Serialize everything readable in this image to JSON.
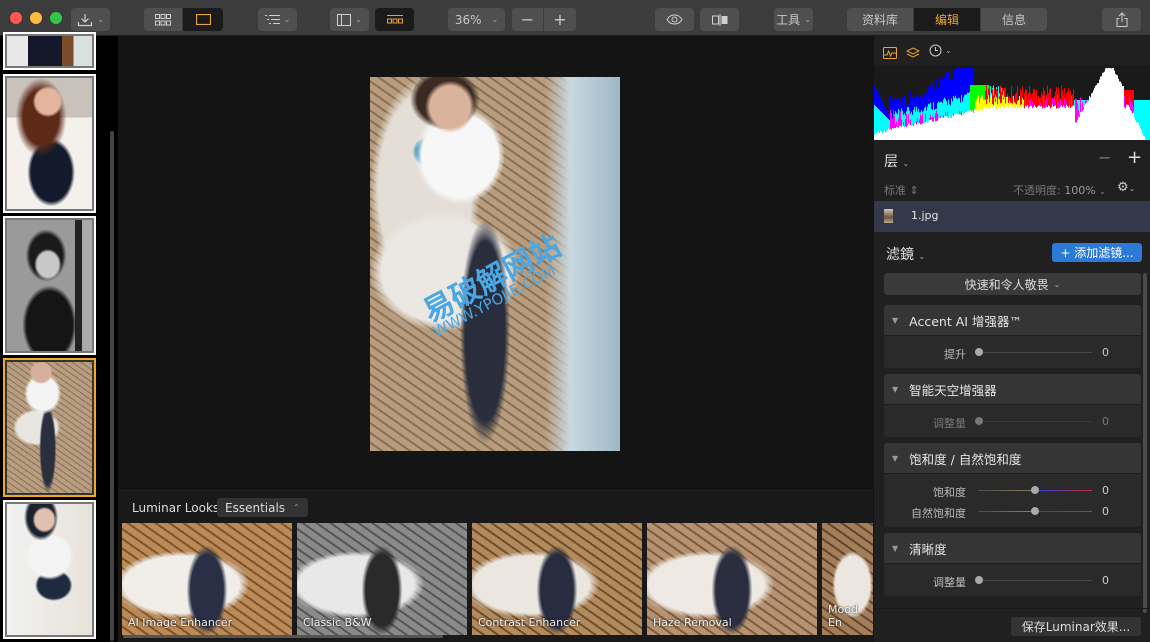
{
  "toolbar": {
    "import_icon": "download-icon",
    "view_modes": [
      {
        "icon": "grid-icon",
        "active": false
      },
      {
        "icon": "single-view-icon",
        "active": true
      }
    ],
    "sort_icon": "list-icon",
    "sidebar_icon": "sidebar-icon",
    "filmstrip_icon": "filmstrip-icon",
    "zoom_level": "36%",
    "zoom_out": "−",
    "zoom_in": "+",
    "preview_icon": "eye-icon",
    "compare_icon": "compare-icon",
    "tools_label": "工具",
    "modes": [
      {
        "label": "资料库",
        "active": false
      },
      {
        "label": "编辑",
        "active": true
      },
      {
        "label": "信息",
        "active": false
      }
    ],
    "share_icon": "share-icon",
    "accent": "#e8a33a"
  },
  "filmstrip": {
    "thumbnails": [
      {
        "name": "photo-black-dress-partial",
        "selected": false
      },
      {
        "name": "photo-redhead-black-dress",
        "selected": false
      },
      {
        "name": "photo-bw-portrait",
        "selected": false
      },
      {
        "name": "photo-white-shirt-chair",
        "selected": true
      },
      {
        "name": "photo-uniform-portrait",
        "selected": false
      }
    ]
  },
  "canvas": {
    "watermark_cn": "易破解网站",
    "watermark_url": "WWW.YPOJIE.COM"
  },
  "looks": {
    "label": "Luminar Looks:",
    "collection": "Essentials",
    "items": [
      {
        "name": "AI Image Enhancer"
      },
      {
        "name": "Classic B&W"
      },
      {
        "name": "Contrast Enhancer"
      },
      {
        "name": "Haze Removal"
      },
      {
        "name": "Mood Enhancer",
        "display": "Mood En"
      }
    ]
  },
  "panel": {
    "tabs": [
      {
        "icon": "histogram-icon",
        "active": true
      },
      {
        "icon": "layers-icon",
        "active": true
      },
      {
        "icon": "history-icon",
        "active": false
      }
    ],
    "layers": {
      "title": "层",
      "remove": "−",
      "add": "+",
      "blend_mode": "标准",
      "opacity_label": "不透明度:",
      "opacity_value": "100%",
      "items": [
        {
          "name": "1.jpg"
        }
      ]
    },
    "filters": {
      "title": "滤鏡",
      "add_button": "+ 添加滤镜...",
      "preset": "快速和令人敬畏",
      "blocks": [
        {
          "title": "Accent AI 增强器™",
          "sliders": [
            {
              "label": "提升",
              "value": "0",
              "position": 0,
              "dim": false
            }
          ]
        },
        {
          "title": "智能天空增强器",
          "sliders": [
            {
              "label": "调整量",
              "value": "0",
              "position": 0,
              "dim": true
            }
          ]
        },
        {
          "title": "饱和度 / 自然饱和度",
          "sliders": [
            {
              "label": "饱和度",
              "value": "0",
              "position": 0.5,
              "dim": false
            },
            {
              "label": "自然饱和度",
              "value": "0",
              "position": 0.5,
              "dim": false
            }
          ]
        },
        {
          "title": "清晰度",
          "sliders": [
            {
              "label": "调整量",
              "value": "0",
              "position": 0,
              "dim": false
            }
          ]
        }
      ]
    },
    "save_button": "保存Luminar效果..."
  }
}
